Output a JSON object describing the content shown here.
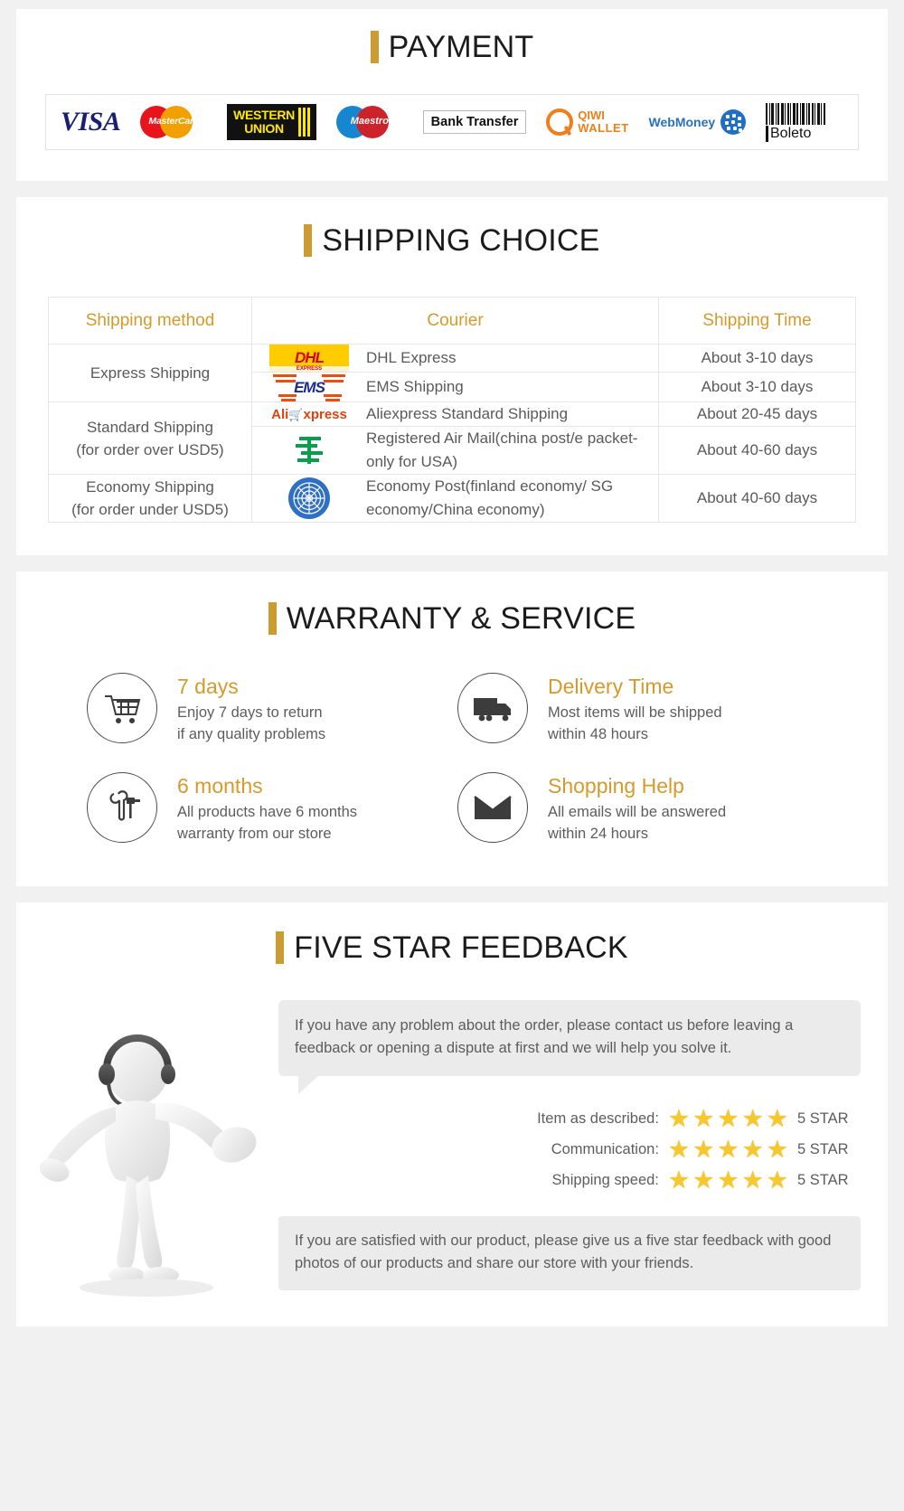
{
  "payment": {
    "title": "PAYMENT",
    "methods": [
      {
        "name": "visa",
        "label": "VISA"
      },
      {
        "name": "mastercard",
        "label": "MasterCard"
      },
      {
        "name": "western-union",
        "label_line1": "WESTERN",
        "label_line2": "UNION"
      },
      {
        "name": "maestro",
        "label": "Maestro"
      },
      {
        "name": "bank-transfer",
        "label": "Bank Transfer"
      },
      {
        "name": "qiwi-wallet",
        "label_line1": "QIWI",
        "label_line2": "WALLET"
      },
      {
        "name": "webmoney",
        "label": "WebMoney"
      },
      {
        "name": "boleto",
        "label": "Boleto"
      }
    ]
  },
  "shipping": {
    "title": "SHIPPING CHOICE",
    "headers": {
      "method": "Shipping method",
      "courier": "Courier",
      "time": "Shipping Time"
    },
    "groups": [
      {
        "method": "Express Shipping",
        "method_note": "",
        "rows": [
          {
            "logo": "dhl-logo",
            "courier": "DHL Express",
            "time": "About 3-10 days"
          },
          {
            "logo": "ems-logo",
            "courier": "EMS Shipping",
            "time": "About 3-10 days"
          }
        ]
      },
      {
        "method": "Standard Shipping",
        "method_note": "(for order over USD5)",
        "rows": [
          {
            "logo": "aliexpress-logo",
            "courier": "Aliexpress Standard Shipping",
            "time": "About 20-45 days"
          },
          {
            "logo": "china-post-logo",
            "courier": "Registered Air Mail(china post/e packet-only for USA)",
            "time": "About 40-60 days"
          }
        ]
      },
      {
        "method": "Economy Shipping",
        "method_note": "(for order under USD5)",
        "rows": [
          {
            "logo": "un-globe-logo",
            "courier": "Economy Post(finland economy/ SG economy/China economy)",
            "time": "About 40-60 days"
          }
        ]
      }
    ]
  },
  "warranty": {
    "title": "WARRANTY & SERVICE",
    "items": [
      {
        "icon": "shopping-cart-icon",
        "heading": "7 days",
        "line1": "Enjoy 7 days to return",
        "line2": "if any quality problems"
      },
      {
        "icon": "delivery-truck-icon",
        "heading": "Delivery Time",
        "line1": "Most items will be shipped",
        "line2": "within 48 hours"
      },
      {
        "icon": "tools-icon",
        "heading": "6 months",
        "line1": "All products have 6 months",
        "line2": "warranty from our store"
      },
      {
        "icon": "envelope-icon",
        "heading": "Shopping Help",
        "line1": "All emails will be answered",
        "line2": "within 24 hours"
      }
    ]
  },
  "feedback": {
    "title": "FIVE STAR FEEDBACK",
    "bubble_text": "If you have any problem about the order, please contact us before leaving a feedback or opening a dispute at first and we will help you solve it.",
    "ratings": [
      {
        "label": "Item as described:",
        "stars": 5,
        "value": "5 STAR"
      },
      {
        "label": "Communication:",
        "stars": 5,
        "value": "5 STAR"
      },
      {
        "label": "Shipping speed:",
        "stars": 5,
        "value": "5 STAR"
      }
    ],
    "closing_text": "If you are satisfied with our product, please give us a five star feedback with good photos of our products and share our store with your friends.",
    "mascot": "support-agent-figure"
  },
  "colors": {
    "accent_gold": "#cc9c33",
    "heading_gold": "#d69a2a",
    "body_gray": "#5d5d5d",
    "star_yellow": "#f6c830"
  }
}
